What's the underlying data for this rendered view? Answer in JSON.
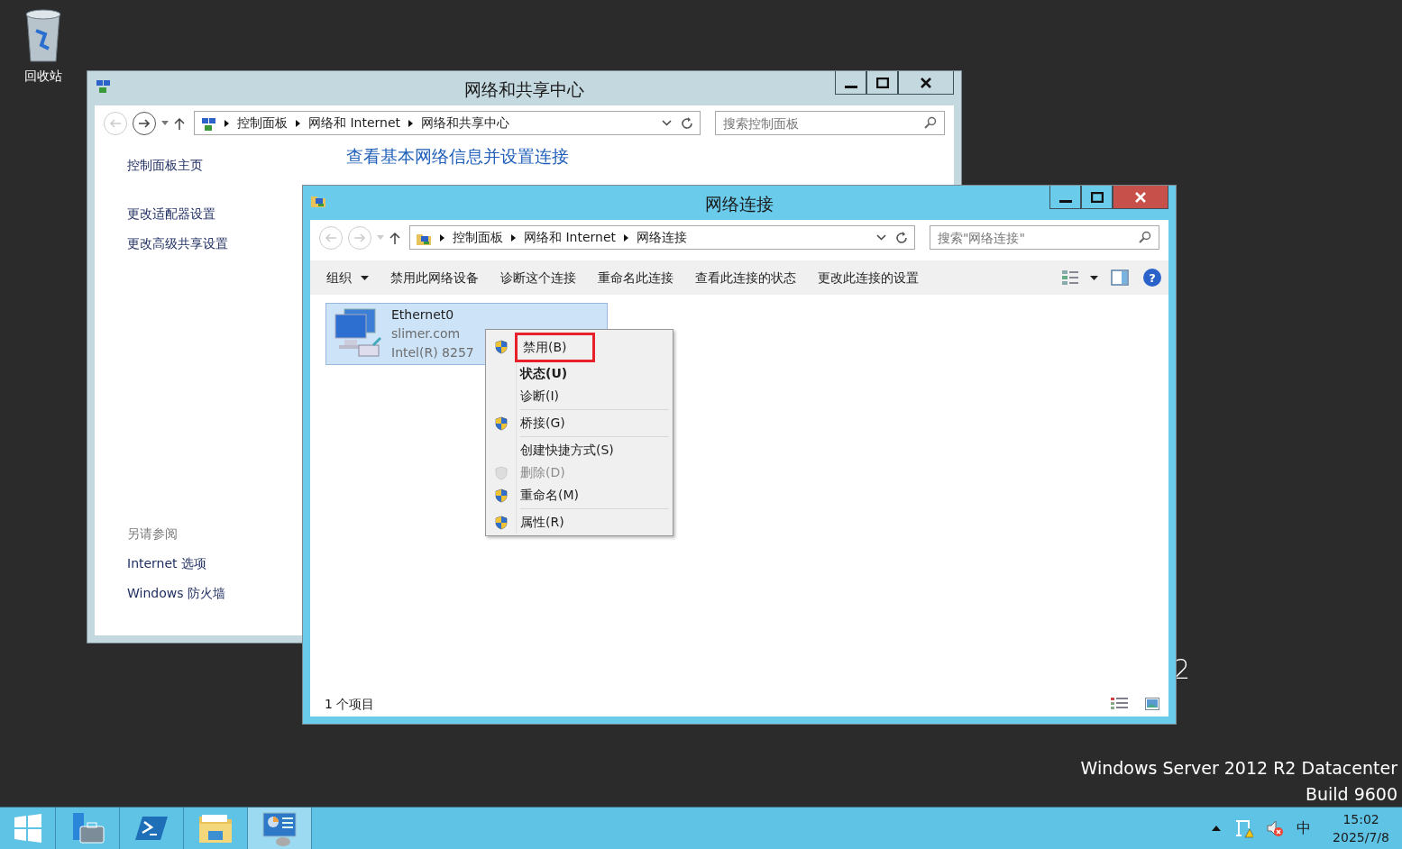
{
  "desktop": {
    "icons": [
      {
        "label": "回收站"
      }
    ],
    "background_text": "2",
    "edition": "Windows Server 2012 R2 Datacenter",
    "build": "Build 9600"
  },
  "sharing_window": {
    "title": "网络和共享中心",
    "active": false,
    "back_enabled": false,
    "forward_enabled": true,
    "breadcrumbs": [
      "控制面板",
      "网络和 Internet",
      "网络和共享中心"
    ],
    "search": {
      "placeholder": "搜索控制面板"
    },
    "sidebar": {
      "links": [
        "控制面板主页",
        "更改适配器设置",
        "更改高级共享设置"
      ],
      "see_also": {
        "heading": "另请参阅",
        "links": [
          "Internet 选项",
          "Windows 防火墙"
        ]
      }
    },
    "heading": "查看基本网络信息并设置连接"
  },
  "connections_window": {
    "title": "网络连接",
    "active": true,
    "back_enabled": false,
    "forward_enabled": false,
    "breadcrumbs": [
      "控制面板",
      "网络和 Internet",
      "网络连接"
    ],
    "search": {
      "placeholder": "搜索\"网络连接\""
    },
    "toolbar": [
      {
        "label": "组织",
        "dropdown": true
      },
      {
        "label": "禁用此网络设备",
        "dropdown": false
      },
      {
        "label": "诊断这个连接",
        "dropdown": false
      },
      {
        "label": "重命名此连接",
        "dropdown": false
      },
      {
        "label": "查看此连接的状态",
        "dropdown": false
      },
      {
        "label": "更改此连接的设置",
        "dropdown": false
      }
    ],
    "help": "?",
    "adapters": [
      {
        "name": "Ethernet0",
        "network": "slimer.com",
        "device": "Intel(R) 8257",
        "selected": true
      }
    ],
    "status": "1 个项目"
  },
  "context_menu": {
    "items": [
      {
        "kind": "item",
        "label": "禁用(B)",
        "shield": true,
        "bold": false,
        "disabled": false,
        "highlighted": true
      },
      {
        "kind": "item",
        "label": "状态(U)",
        "shield": false,
        "bold": true,
        "disabled": false,
        "highlighted": false
      },
      {
        "kind": "item",
        "label": "诊断(I)",
        "shield": false,
        "bold": false,
        "disabled": false,
        "highlighted": false
      },
      {
        "kind": "separator"
      },
      {
        "kind": "item",
        "label": "桥接(G)",
        "shield": true,
        "bold": false,
        "disabled": false,
        "highlighted": false
      },
      {
        "kind": "separator"
      },
      {
        "kind": "item",
        "label": "创建快捷方式(S)",
        "shield": false,
        "bold": false,
        "disabled": false,
        "highlighted": false
      },
      {
        "kind": "item",
        "label": "删除(D)",
        "shield": true,
        "bold": false,
        "disabled": true,
        "highlighted": false
      },
      {
        "kind": "item",
        "label": "重命名(M)",
        "shield": true,
        "bold": false,
        "disabled": false,
        "highlighted": false
      },
      {
        "kind": "separator"
      },
      {
        "kind": "item",
        "label": "属性(R)",
        "shield": true,
        "bold": false,
        "disabled": false,
        "highlighted": false
      }
    ]
  },
  "taskbar": {
    "apps": [
      {
        "kind": "start",
        "active": false
      },
      {
        "kind": "server-manager",
        "active": false
      },
      {
        "kind": "powershell",
        "active": false
      },
      {
        "kind": "explorer",
        "active": false
      },
      {
        "kind": "control-panel",
        "active": true
      }
    ],
    "tray": {
      "ime": "中",
      "time": "15:02",
      "date": "2025/7/8"
    }
  }
}
